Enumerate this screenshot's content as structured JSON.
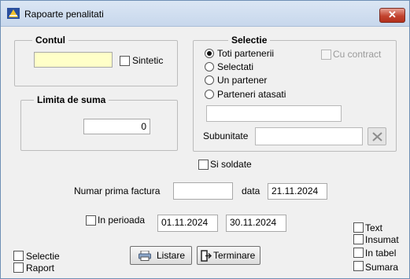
{
  "window": {
    "title": "Rapoarte penalitati",
    "close_label": "✕"
  },
  "contul": {
    "legend": "Contul",
    "account_value": "",
    "sintetic_label": "Sintetic",
    "sintetic_checked": false
  },
  "limita": {
    "legend": "Limita de suma",
    "value": "0"
  },
  "selectie": {
    "legend": "Selectie",
    "options": [
      "Toti partenerii",
      "Selectati",
      "Un partener",
      "Parteneri atasati"
    ],
    "selected_index": 0,
    "cu_contract_label": "Cu contract",
    "partner_value": "",
    "subunitate_label": "Subunitate",
    "subunitate_value": ""
  },
  "si_soldate": {
    "label": "Si soldate",
    "checked": false
  },
  "factura": {
    "label": "Numar prima factura",
    "value": "",
    "data_label": "data",
    "data_value": "21.11.2024"
  },
  "perioada": {
    "label": "In perioada",
    "checked": false,
    "from": "01.11.2024",
    "to": "30.11.2024"
  },
  "output_options": {
    "text": "Text",
    "insumat": "Insumat",
    "in_tabel": "In tabel",
    "sumara": "Sumara"
  },
  "bottom_left": {
    "selectie": "Selectie",
    "raport": "Raport"
  },
  "buttons": {
    "listare": "Listare",
    "terminare": "Terminare"
  }
}
